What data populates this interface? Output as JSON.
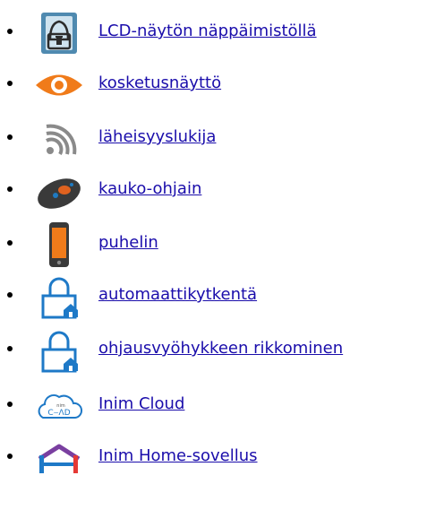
{
  "items": [
    {
      "label": "LCD-näytön näppäimistöllä",
      "icon": "keypad-icon"
    },
    {
      "label": "kosketusnäyttö",
      "icon": "eye-icon"
    },
    {
      "label": "läheisyyslukija",
      "icon": "proximity-icon"
    },
    {
      "label": "kauko-ohjain",
      "icon": "remote-icon"
    },
    {
      "label": "puhelin",
      "icon": "phone-icon"
    },
    {
      "label": "automaattikytkentä",
      "icon": "lock-home-icon"
    },
    {
      "label": "ohjausvyöhykkeen rikkominen",
      "icon": "lock-home-icon"
    },
    {
      "label": "Inim Cloud",
      "icon": "cloud-icon"
    },
    {
      "label": "Inim Home-sovellus",
      "icon": "home-app-icon"
    }
  ],
  "colors": {
    "link": "#1a0dab",
    "accent_orange": "#f07b1a",
    "lock_blue": "#1e79c7"
  }
}
